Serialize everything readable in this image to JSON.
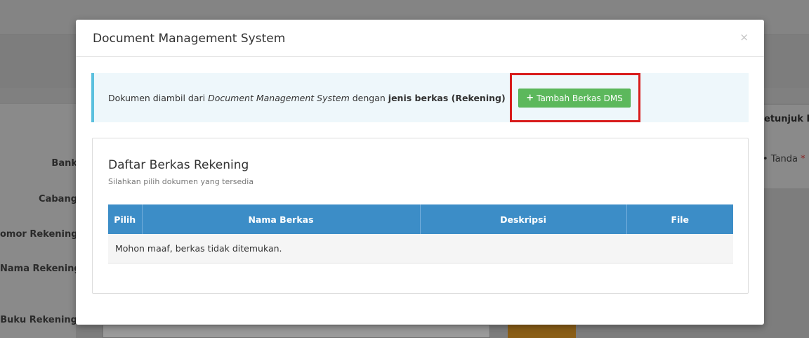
{
  "background": {
    "labels": {
      "bank": "Bank",
      "cabang": "Cabang",
      "nomor_rekening": "omor Rekening",
      "nama_rekening": "Nama Rekening",
      "buku_rekening": "Buku Rekening"
    },
    "right_panel": {
      "title": "etunjuk I",
      "item_prefix": "• Tanda ",
      "item_star": "*"
    }
  },
  "modal": {
    "title": "Document Management System",
    "close_glyph": "×",
    "alert": {
      "text_prefix": "Dokumen diambil dari ",
      "text_italic": "Document Management System",
      "text_middle": " dengan ",
      "text_bold": "jenis berkas (Rekening)",
      "button_icon": "plus-icon",
      "button_label": "Tambah Berkas DMS"
    },
    "panel": {
      "title": "Daftar Berkas Rekening",
      "subtitle": "Silahkan pilih dokumen yang tersedia",
      "columns": [
        "Pilih",
        "Nama Berkas",
        "Deskripsi",
        "File"
      ],
      "empty_message": "Mohon maaf, berkas tidak ditemukan."
    }
  },
  "colors": {
    "accent_blue": "#3c8dc7",
    "info_border": "#5bc0de",
    "success_green": "#5cb85c",
    "highlight_red": "#d81c1c"
  }
}
